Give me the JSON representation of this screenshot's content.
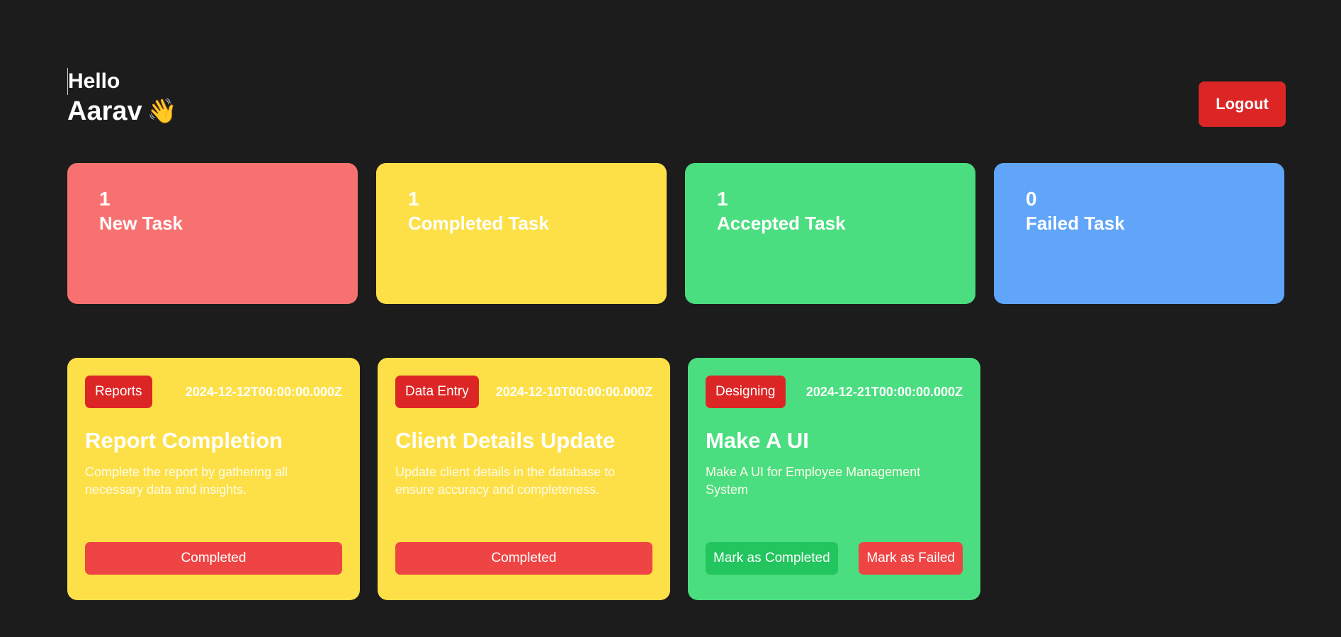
{
  "header": {
    "hello": "Hello",
    "name": "Aarav",
    "wave_emoji": "👋",
    "logout_label": "Logout"
  },
  "stats": [
    {
      "count": "1",
      "label": "New Task",
      "color": "#f87171"
    },
    {
      "count": "1",
      "label": "Completed Task",
      "color": "#fde047"
    },
    {
      "count": "1",
      "label": "Accepted Task",
      "color": "#4ade80"
    },
    {
      "count": "0",
      "label": "Failed Task",
      "color": "#60a5fa"
    }
  ],
  "tasks": [
    {
      "category": "Reports",
      "date": "2024-12-12T00:00:00.000Z",
      "title": "Report Completion",
      "description": "Complete the report by gathering all necessary data and insights.",
      "status_label": "Completed",
      "color": "#fde047"
    },
    {
      "category": "Data Entry",
      "date": "2024-12-10T00:00:00.000Z",
      "title": "Client Details Update",
      "description": "Update client details in the database to ensure accuracy and completeness.",
      "status_label": "Completed",
      "color": "#fde047"
    },
    {
      "category": "Designing",
      "date": "2024-12-21T00:00:00.000Z",
      "title": "Make A UI",
      "description": "Make A UI for Employee Management System",
      "complete_label": "Mark as Completed",
      "fail_label": "Mark as Failed",
      "color": "#4ade80"
    }
  ],
  "colors": {
    "background": "#1c1c1c",
    "danger": "#dc2626",
    "success": "#22c55e"
  }
}
